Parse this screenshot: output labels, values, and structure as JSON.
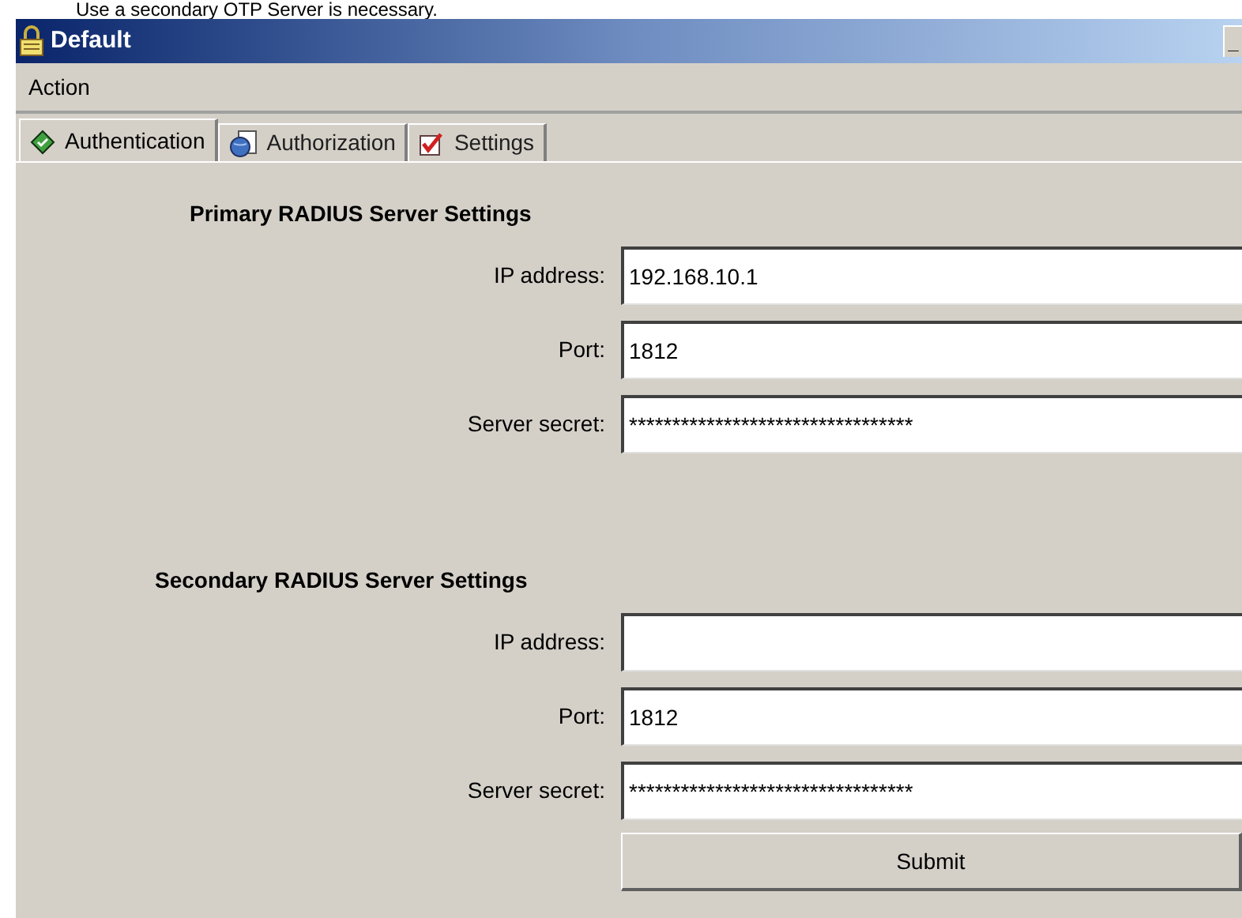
{
  "caption": "Use a secondary OTP Server is necessary.",
  "window": {
    "title": "Default",
    "minimize": "_"
  },
  "menu": [
    "Action"
  ],
  "tabs": [
    {
      "label": "Authentication",
      "selected": true
    },
    {
      "label": "Authorization",
      "selected": false
    },
    {
      "label": "Settings",
      "selected": false
    }
  ],
  "sections": [
    {
      "heading": "Primary RADIUS Server Settings",
      "fields": [
        {
          "label": "IP address:",
          "value": "192.168.10.1"
        },
        {
          "label": "Port:",
          "value": "1812"
        },
        {
          "label": "Server secret:",
          "value": "*********************************"
        }
      ]
    },
    {
      "heading": "Secondary RADIUS Server Settings",
      "fields": [
        {
          "label": "IP address:"
        },
        {
          "label": "Port:",
          "value": "1812"
        },
        {
          "label": "Server secret:",
          "value": "*********************************"
        }
      ]
    }
  ],
  "submit": "Submit"
}
